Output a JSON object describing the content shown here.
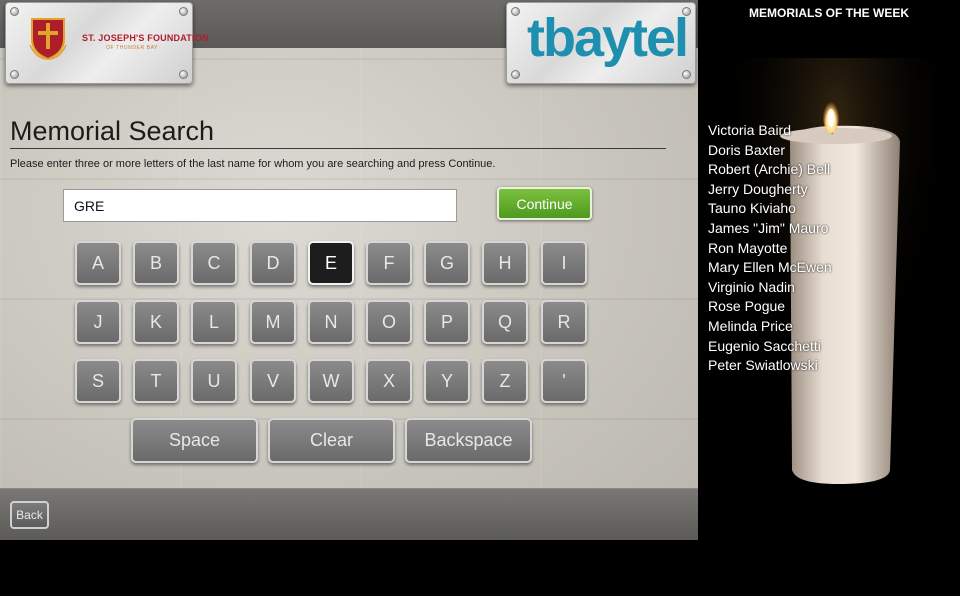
{
  "header": {
    "left_logo": {
      "name": "ST. JOSEPH'S FOUNDATION",
      "subtitle": "OF THUNDER BAY",
      "icon": "crest-icon",
      "colors": {
        "red": "#b01d2a",
        "gold": "#e1a42b"
      }
    },
    "right_logo": {
      "text": "tbaytel",
      "color": "#1f8fb0"
    }
  },
  "main": {
    "title": "Memorial Search",
    "instructions": "Please enter three or more letters of the last name for whom you are searching and press Continue.",
    "search": {
      "value": "GRE",
      "placeholder": ""
    },
    "continue_label": "Continue",
    "keyboard": {
      "active_key": "E",
      "rows": [
        [
          "A",
          "B",
          "C",
          "D",
          "E",
          "F",
          "G",
          "H",
          "I"
        ],
        [
          "J",
          "K",
          "L",
          "M",
          "N",
          "O",
          "P",
          "Q",
          "R"
        ],
        [
          "S",
          "T",
          "U",
          "V",
          "W",
          "X",
          "Y",
          "Z",
          "'"
        ]
      ],
      "space_label": "Space",
      "clear_label": "Clear",
      "backspace_label": "Backspace"
    },
    "back_label": "Back"
  },
  "memorials": {
    "heading": "MEMORIALS OF THE WEEK",
    "names": [
      "Victoria Baird",
      "Doris Baxter",
      "Robert (Archie) Bell",
      "Jerry Dougherty",
      "Tauno Kiviaho",
      "James \"Jim\" Mauro",
      "Ron Mayotte",
      "Mary Ellen McEwen",
      "Virginio Nadin",
      "Rose Pogue",
      "Melinda Price",
      "Eugenio Sacchetti",
      "Peter Swiatlowski"
    ],
    "image": "candle-icon"
  },
  "colors": {
    "continue_green": "#5aab2a",
    "key_gray": "#7a7a7a",
    "active_key": "#1d1d1d"
  }
}
